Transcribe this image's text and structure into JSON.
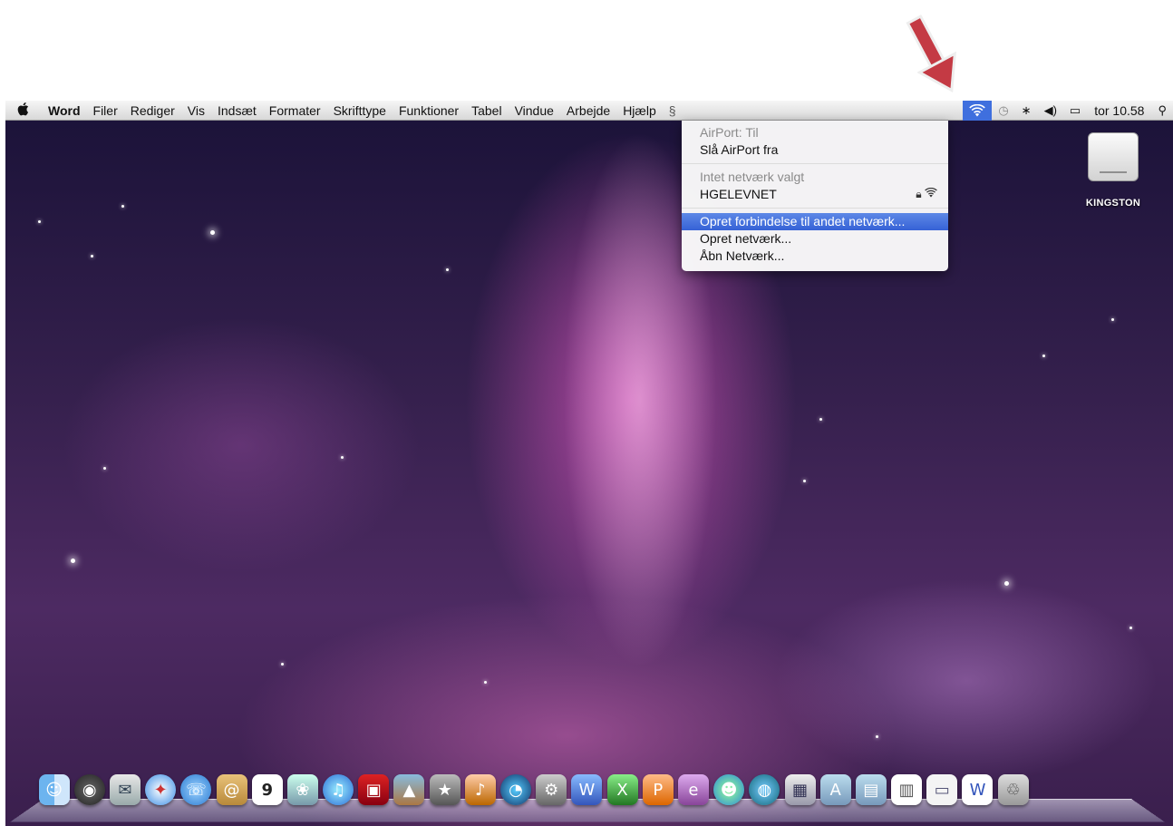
{
  "menubar": {
    "app_name": "Word",
    "menus": [
      "Filer",
      "Rediger",
      "Vis",
      "Indsæt",
      "Formater",
      "Skrifttype",
      "Funktioner",
      "Tabel",
      "Vindue",
      "Arbejde",
      "Hjælp"
    ],
    "clock": "tor 10.58"
  },
  "airport_menu": {
    "status": "AirPort: Til",
    "toggle": "Slå AirPort fra",
    "no_network": "Intet netværk valgt",
    "network_name": "HGELEVNET",
    "connect_other": "Opret forbindelse til andet netværk...",
    "create_network": "Opret netværk...",
    "open_network": "Åbn Netværk..."
  },
  "desktop": {
    "drive_label": "KINGSTON"
  },
  "colors": {
    "highlight": "#3662d6",
    "arrow": "#c0303a"
  },
  "dock_icons": [
    "finder-icon",
    "dashboard-icon",
    "mail-icon",
    "safari-icon",
    "ichat-icon",
    "address-book-icon",
    "ical-icon",
    "preview-icon",
    "itunes-icon",
    "photo-booth-icon",
    "iphoto-icon",
    "imovie-icon",
    "garageband-icon",
    "time-machine-icon",
    "system-preferences-icon",
    "word-icon",
    "excel-icon",
    "powerpoint-icon",
    "entourage-icon",
    "messenger-icon",
    "remote-desktop-icon",
    "spaces-icon",
    "applications-folder-icon",
    "documents-folder-icon",
    "pdf-document-icon",
    "screenshot-document-icon",
    "word-document-icon",
    "trash-icon"
  ]
}
